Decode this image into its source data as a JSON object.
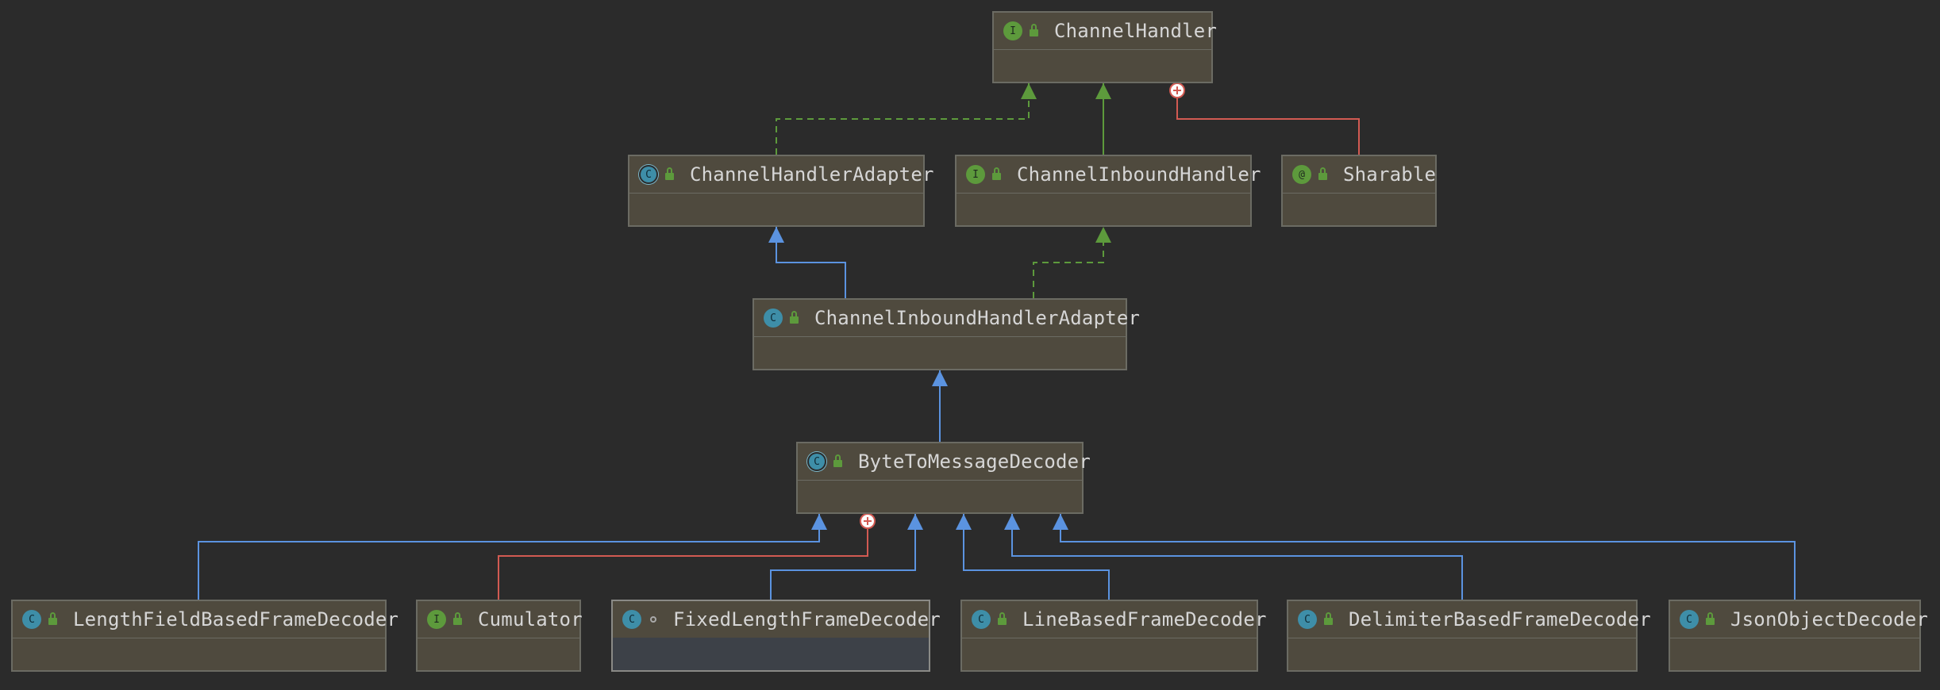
{
  "colors": {
    "background": "#2b2b2b",
    "extends": "#5b93e0",
    "implements": "#5d9a3c",
    "inner": "#d25a52"
  },
  "nodes": [
    {
      "id": "ChannelHandler",
      "label": "ChannelHandler",
      "kind": "interface",
      "visibility": "public"
    },
    {
      "id": "ChannelHandlerAdapter",
      "label": "ChannelHandlerAdapter",
      "kind": "abstract-class",
      "visibility": "public"
    },
    {
      "id": "ChannelInboundHandler",
      "label": "ChannelInboundHandler",
      "kind": "interface",
      "visibility": "public"
    },
    {
      "id": "Sharable",
      "label": "Sharable",
      "kind": "annotation",
      "visibility": "public"
    },
    {
      "id": "ChannelInboundHandlerAdapter",
      "label": "ChannelInboundHandlerAdapter",
      "kind": "class",
      "visibility": "public"
    },
    {
      "id": "ByteToMessageDecoder",
      "label": "ByteToMessageDecoder",
      "kind": "abstract-class",
      "visibility": "public"
    },
    {
      "id": "LengthFieldBasedFrameDecoder",
      "label": "LengthFieldBasedFrameDecoder",
      "kind": "class",
      "visibility": "public"
    },
    {
      "id": "Cumulator",
      "label": "Cumulator",
      "kind": "interface",
      "visibility": "public"
    },
    {
      "id": "FixedLengthFrameDecoder",
      "label": "FixedLengthFrameDecoder",
      "kind": "class",
      "visibility": "package",
      "selected": true
    },
    {
      "id": "LineBasedFrameDecoder",
      "label": "LineBasedFrameDecoder",
      "kind": "class",
      "visibility": "public"
    },
    {
      "id": "DelimiterBasedFrameDecoder",
      "label": "DelimiterBasedFrameDecoder",
      "kind": "class",
      "visibility": "public"
    },
    {
      "id": "JsonObjectDecoder",
      "label": "JsonObjectDecoder",
      "kind": "class",
      "visibility": "public"
    }
  ],
  "edges": [
    {
      "from": "ChannelHandlerAdapter",
      "to": "ChannelHandler",
      "type": "implements"
    },
    {
      "from": "ChannelInboundHandler",
      "to": "ChannelHandler",
      "type": "extends-interface"
    },
    {
      "from": "Sharable",
      "to": "ChannelHandler",
      "type": "inner"
    },
    {
      "from": "ChannelInboundHandlerAdapter",
      "to": "ChannelHandlerAdapter",
      "type": "extends"
    },
    {
      "from": "ChannelInboundHandlerAdapter",
      "to": "ChannelInboundHandler",
      "type": "implements"
    },
    {
      "from": "ByteToMessageDecoder",
      "to": "ChannelInboundHandlerAdapter",
      "type": "extends"
    },
    {
      "from": "LengthFieldBasedFrameDecoder",
      "to": "ByteToMessageDecoder",
      "type": "extends"
    },
    {
      "from": "Cumulator",
      "to": "ByteToMessageDecoder",
      "type": "inner"
    },
    {
      "from": "FixedLengthFrameDecoder",
      "to": "ByteToMessageDecoder",
      "type": "extends"
    },
    {
      "from": "LineBasedFrameDecoder",
      "to": "ByteToMessageDecoder",
      "type": "extends"
    },
    {
      "from": "DelimiterBasedFrameDecoder",
      "to": "ByteToMessageDecoder",
      "type": "extends"
    },
    {
      "from": "JsonObjectDecoder",
      "to": "ByteToMessageDecoder",
      "type": "extends"
    }
  ]
}
